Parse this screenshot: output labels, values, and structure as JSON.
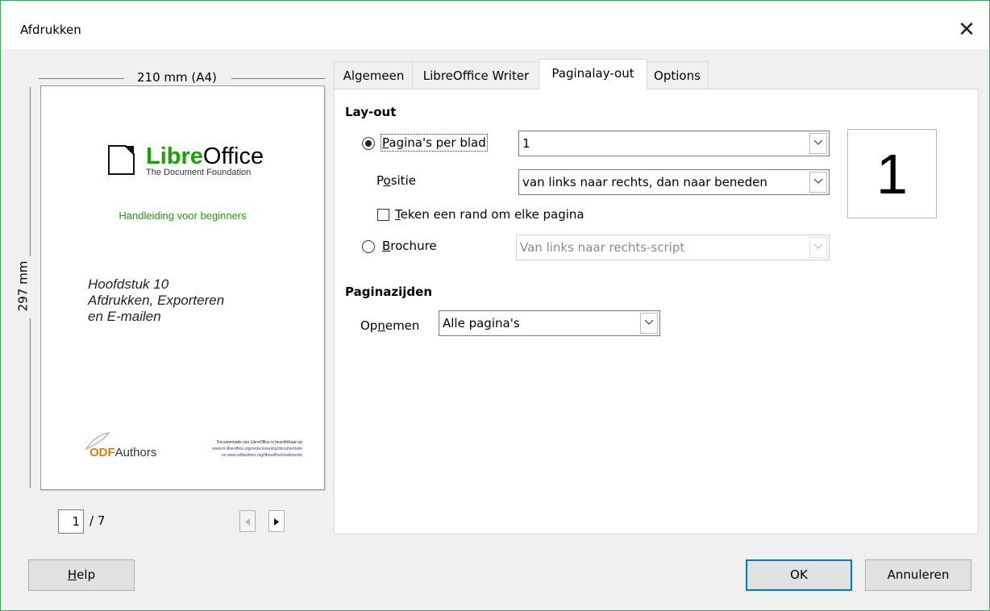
{
  "window": {
    "title": "Afdrukken",
    "close_glyph": "✕"
  },
  "preview": {
    "width_label": "210 mm (A4)",
    "height_label": "297 mm",
    "logo_bold": "Libre",
    "logo_regular": "Office",
    "logo_sub": "The Document Foundation",
    "guide": "Handleiding voor beginners",
    "chapter_lines": [
      "Hoofdstuk 10",
      "Afdrukken, Exporteren",
      "en E-mailen"
    ],
    "odf_first": "ODF",
    "odf_rest": "Authors",
    "fineprint_lines": [
      "Documentatie van LibreOffice is beschikbaar op",
      "www.nl.libreoffice.org/ondersteuning/documentatie",
      "en www.odfauthors.org/libreoffice/nederlands"
    ],
    "page_current": "1",
    "page_total": "/ 7"
  },
  "tabs": [
    {
      "label": "Algemeen",
      "active": false
    },
    {
      "label": "LibreOffice Writer",
      "active": false
    },
    {
      "label": "Paginalay-out",
      "active": true
    },
    {
      "label": "Options",
      "active": false
    }
  ],
  "layout": {
    "section": "Lay-out",
    "pages_per_sheet": {
      "label_u": "P",
      "label_rest": "agina's per blad",
      "value": "1",
      "selected": true
    },
    "position": {
      "label_pre": "P",
      "label_u": "o",
      "label_rest": "sitie",
      "value": "van links naar rechts, dan naar beneden"
    },
    "border": {
      "label_u": "T",
      "label_rest": "eken een rand om elke pagina",
      "checked": false
    },
    "brochure": {
      "label_u": "B",
      "label_rest": "rochure",
      "value": "Van links naar rechts-script",
      "selected": false,
      "disabled": true
    },
    "preview_number": "1"
  },
  "page_sides": {
    "section": "Paginazijden",
    "include": {
      "label_pre": "Op",
      "label_u": "n",
      "label_rest": "emen",
      "value": "Alle pagina's"
    }
  },
  "buttons": {
    "help_u": "H",
    "help_rest": "elp",
    "ok": "OK",
    "cancel": "Annuleren"
  }
}
